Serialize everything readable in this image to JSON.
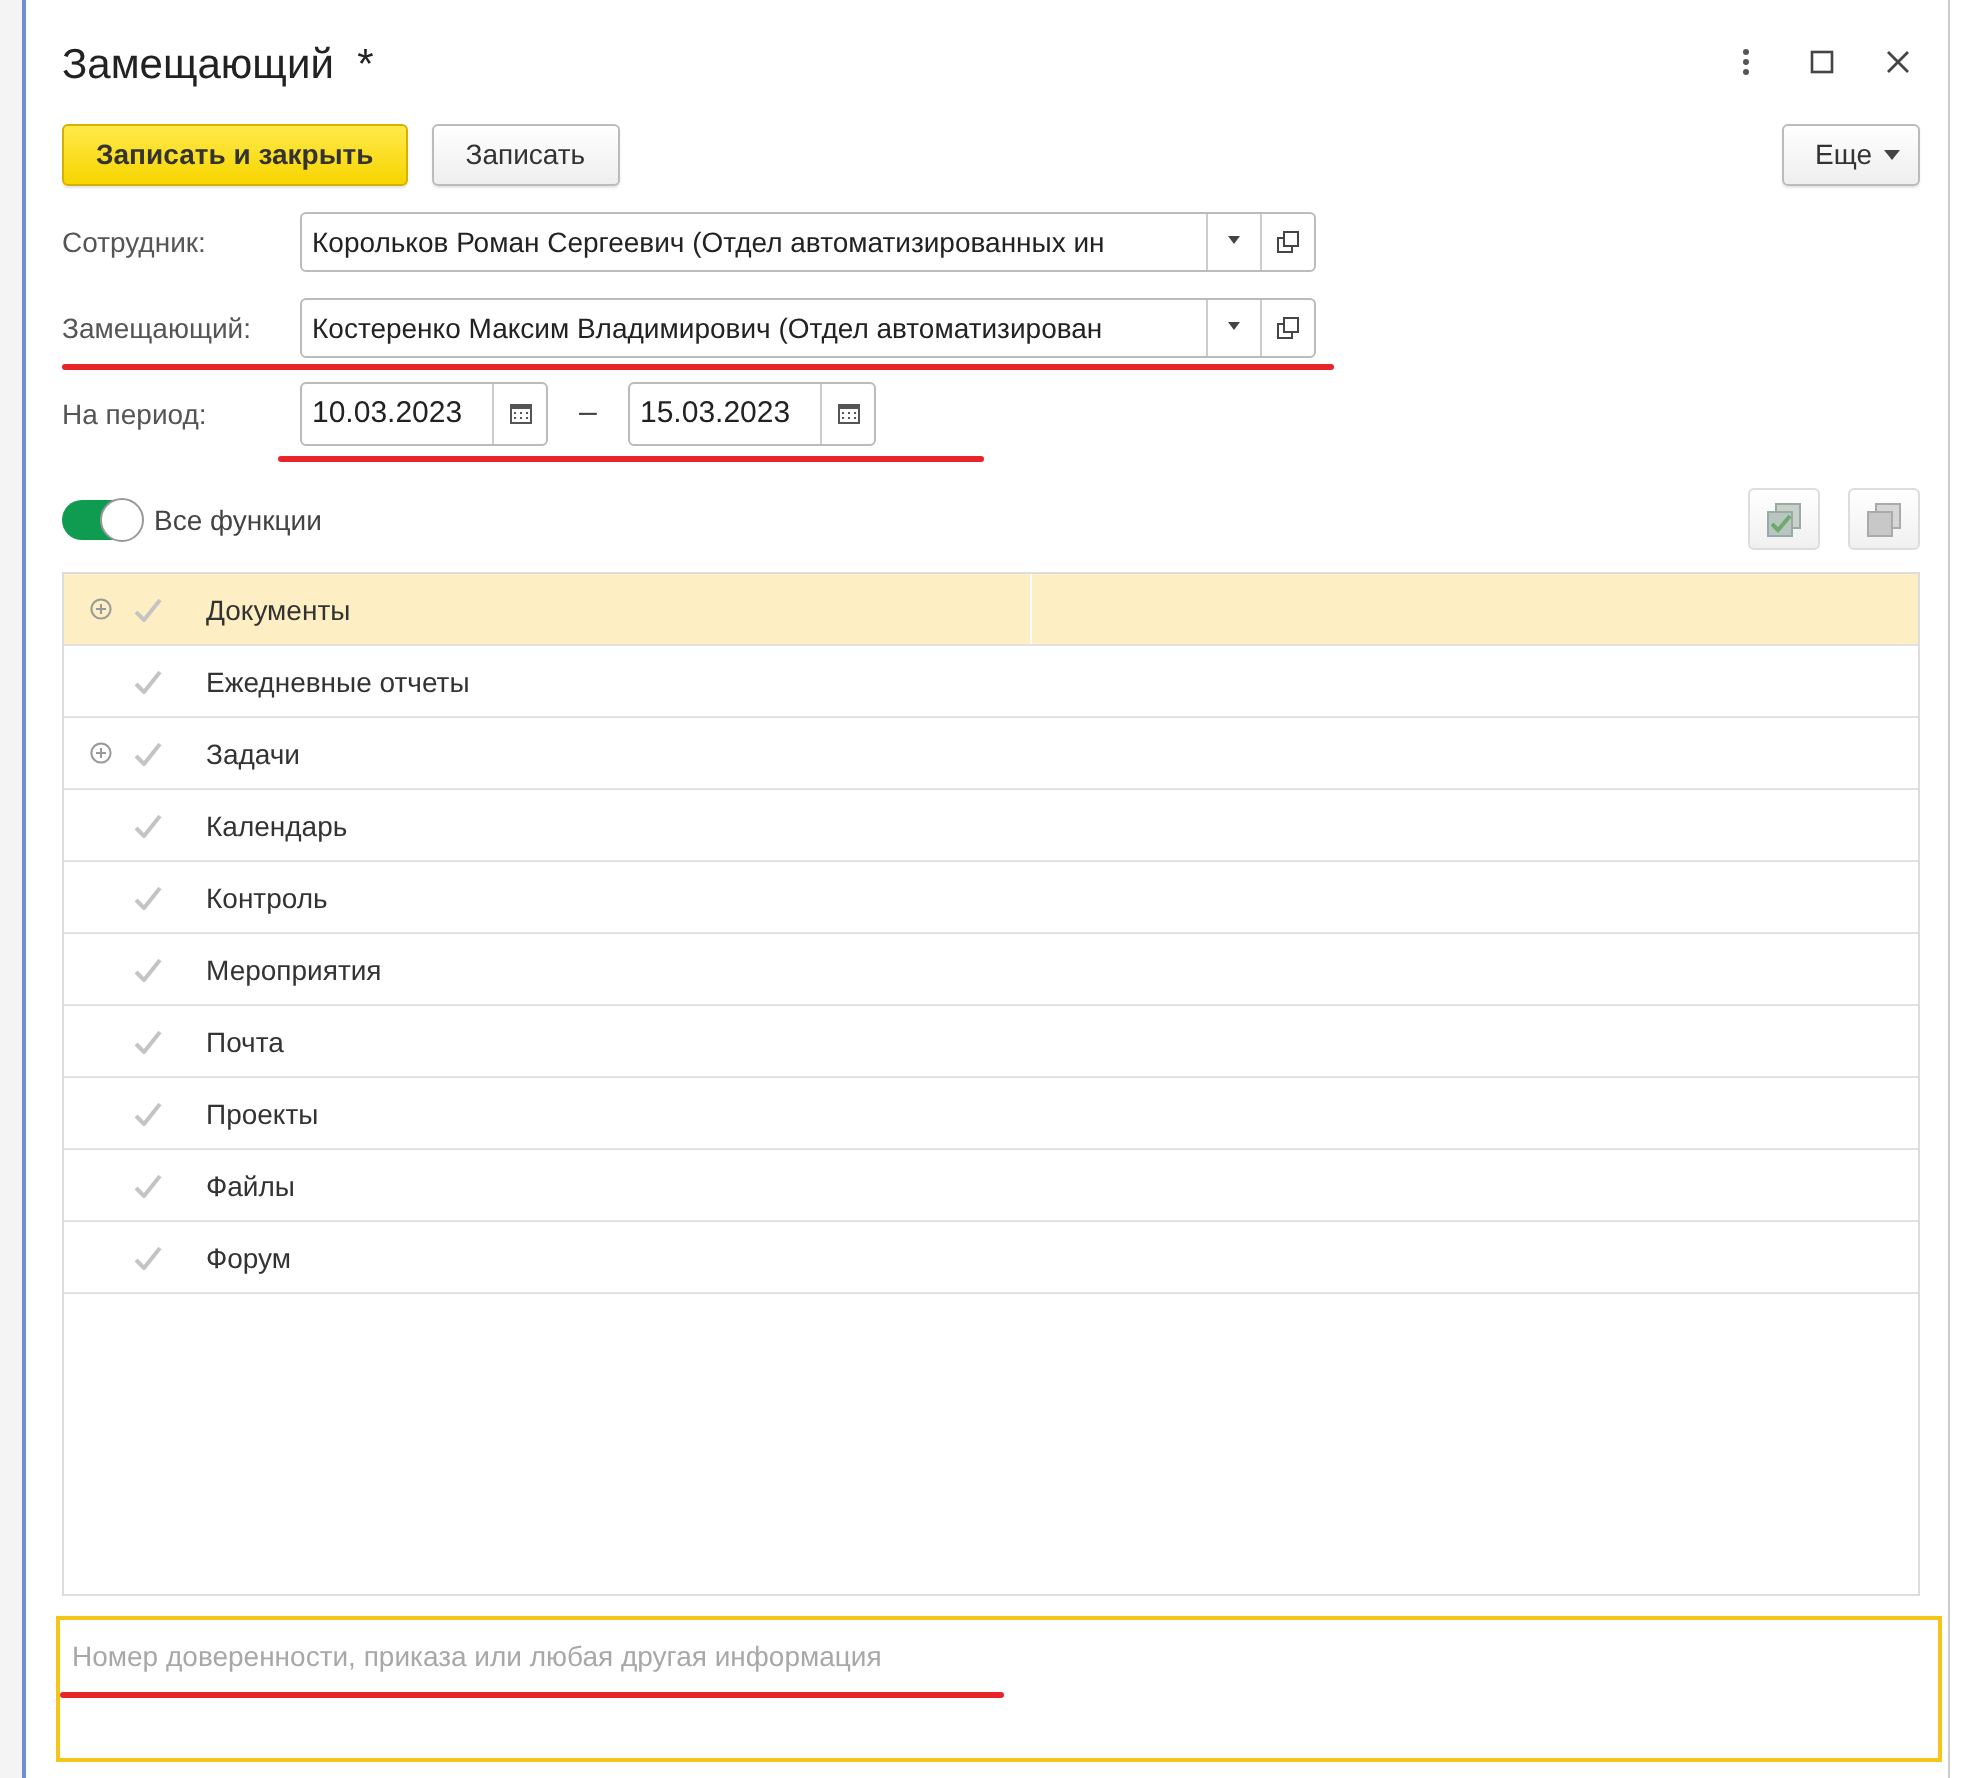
{
  "window": {
    "title": "Замещающий",
    "modified_mark": "*"
  },
  "toolbar": {
    "buttons": [
      {
        "label": "Записать и закрыть",
        "kind": "primary"
      },
      {
        "label": "Записать",
        "kind": "normal"
      }
    ],
    "more": "Еще"
  },
  "fields": [
    {
      "label": "Сотрудник:",
      "value": "Корольков Роман Сергеевич (Отдел автоматизированных ин",
      "underlined": false
    },
    {
      "label": "Замещающий:",
      "value": "Костеренко Максим Владимирович (Отдел автоматизирован",
      "underlined": true
    }
  ],
  "period": {
    "label": "На период:",
    "from": "10.03.2023",
    "separator": "–",
    "to": "15.03.2023",
    "underlined": true
  },
  "all_functions": {
    "label": "Все функции",
    "on": true
  },
  "functions": [
    {
      "name": "Документы",
      "expandable": true,
      "checked": true,
      "selected": true
    },
    {
      "name": "Ежедневные отчеты",
      "expandable": false,
      "checked": true,
      "selected": false
    },
    {
      "name": "Задачи",
      "expandable": true,
      "checked": true,
      "selected": false
    },
    {
      "name": "Календарь",
      "expandable": false,
      "checked": true,
      "selected": false
    },
    {
      "name": "Контроль",
      "expandable": false,
      "checked": true,
      "selected": false
    },
    {
      "name": "Мероприятия",
      "expandable": false,
      "checked": true,
      "selected": false
    },
    {
      "name": "Почта",
      "expandable": false,
      "checked": true,
      "selected": false
    },
    {
      "name": "Проекты",
      "expandable": false,
      "checked": true,
      "selected": false
    },
    {
      "name": "Файлы",
      "expandable": false,
      "checked": true,
      "selected": false
    },
    {
      "name": "Форум",
      "expandable": false,
      "checked": true,
      "selected": false
    }
  ],
  "comment": {
    "placeholder": "Номер доверенности, приказа или любая другая информация",
    "underlined": true
  }
}
